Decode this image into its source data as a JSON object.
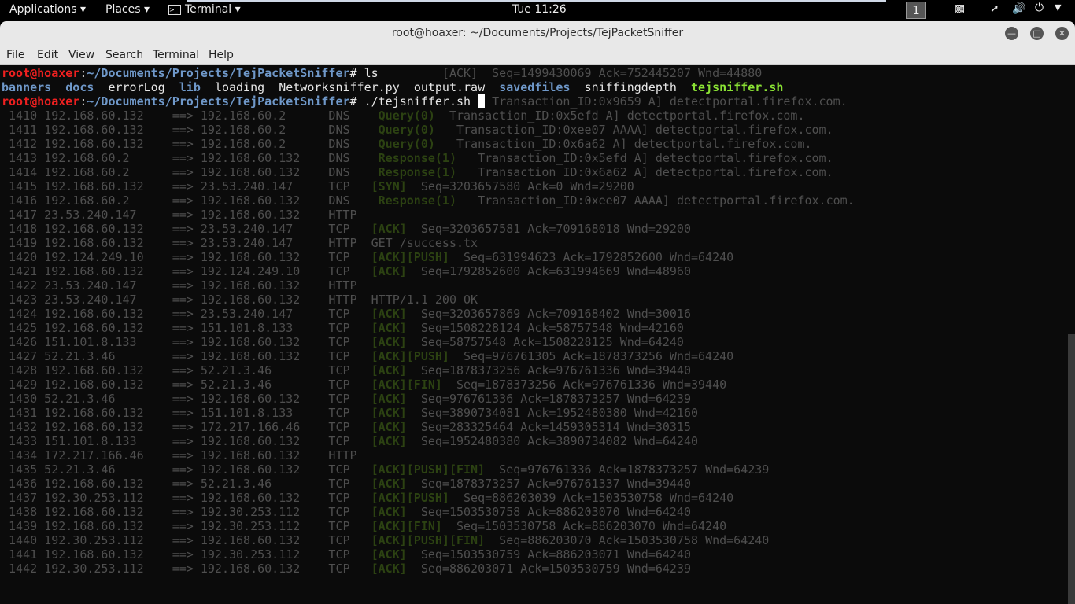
{
  "topbar": {
    "applications": "Applications ▾",
    "places": "Places ▾",
    "terminal": "Terminal ▾",
    "clock": "Tue 11:26",
    "workspace": "1",
    "icons": [
      "camera-icon",
      "network-icon",
      "volume-icon",
      "power-icon",
      "chevron-down-icon"
    ]
  },
  "window": {
    "title": "root@hoaxer: ~/Documents/Projects/TejPacketSniffer",
    "buttons": [
      "minimize",
      "maximize",
      "close"
    ]
  },
  "menu": [
    "File",
    "Edit",
    "View",
    "Search",
    "Terminal",
    "Help"
  ],
  "colors": {
    "prompt_user": "#ee2020",
    "prompt_path": "#6f98c9",
    "executable": "#8ae234",
    "flag": "#2c4212",
    "output": "#4f4f4f"
  },
  "prompt": {
    "user": "root@hoaxer",
    "path": "~/Documents/Projects/TejPacketSniffer",
    "cmd1": "ls",
    "cmd2": "./tejsniffer.sh"
  },
  "ls": [
    {
      "name": "banners",
      "type": "dir"
    },
    {
      "name": "docs",
      "type": "dir"
    },
    {
      "name": "errorLog",
      "type": "file"
    },
    {
      "name": "lib",
      "type": "dir"
    },
    {
      "name": "loading",
      "type": "file"
    },
    {
      "name": "Networksniffer.py",
      "type": "file"
    },
    {
      "name": "output.raw",
      "type": "file"
    },
    {
      "name": "savedfiles",
      "type": "dir"
    },
    {
      "name": "sniffingdepth",
      "type": "file"
    },
    {
      "name": "tejsniffer.sh",
      "type": "exec"
    }
  ],
  "remnants": {
    "line1": "[ACK]  Seq=1499430069 Ack=752445207 Wnd=44880",
    "line3": "Transaction_ID:0x9659 A] detectportal.firefox.com."
  },
  "packets": [
    {
      "n": "1410",
      "src": "192.168.60.132",
      "dst": "192.168.60.2",
      "proto": "DNS",
      "flag": "Query(0)",
      "info": "Transaction_ID:0x5efd A] detectportal.firefox.com."
    },
    {
      "n": "1411",
      "src": "192.168.60.132",
      "dst": "192.168.60.2",
      "proto": "DNS",
      "flag": "Query(0)",
      "info": " Transaction_ID:0xee07 AAAA] detectportal.firefox.com."
    },
    {
      "n": "1412",
      "src": "192.168.60.132",
      "dst": "192.168.60.2",
      "proto": "DNS",
      "flag": "Query(0)",
      "info": " Transaction_ID:0x6a62 A] detectportal.firefox.com."
    },
    {
      "n": "1413",
      "src": "192.168.60.2",
      "dst": "192.168.60.132",
      "proto": "DNS",
      "flag": "Response(1)",
      "info": " Transaction_ID:0x5efd A] detectportal.firefox.com."
    },
    {
      "n": "1414",
      "src": "192.168.60.2",
      "dst": "192.168.60.132",
      "proto": "DNS",
      "flag": "Response(1)",
      "info": " Transaction_ID:0x6a62 A] detectportal.firefox.com."
    },
    {
      "n": "1415",
      "src": "192.168.60.132",
      "dst": "23.53.240.147",
      "proto": "TCP",
      "flag": "[SYN]",
      "info": "Seq=3203657580 Ack=0 Wnd=29200"
    },
    {
      "n": "1416",
      "src": "192.168.60.2",
      "dst": "192.168.60.132",
      "proto": "DNS",
      "flag": "Response(1)",
      "info": " Transaction_ID:0xee07 AAAA] detectportal.firefox.com."
    },
    {
      "n": "1417",
      "src": "23.53.240.147",
      "dst": "192.168.60.132",
      "proto": "HTTP",
      "flag": "",
      "info": ""
    },
    {
      "n": "1418",
      "src": "192.168.60.132",
      "dst": "23.53.240.147",
      "proto": "TCP",
      "flag": "[ACK]",
      "info": "Seq=3203657581 Ack=709168018 Wnd=29200"
    },
    {
      "n": "1419",
      "src": "192.168.60.132",
      "dst": "23.53.240.147",
      "proto": "HTTP",
      "flag": "",
      "info": "GET /success.tx"
    },
    {
      "n": "1420",
      "src": "192.124.249.10",
      "dst": "192.168.60.132",
      "proto": "TCP",
      "flag": "[ACK][PUSH]",
      "info": "Seq=631994623 Ack=1792852600 Wnd=64240"
    },
    {
      "n": "1421",
      "src": "192.168.60.132",
      "dst": "192.124.249.10",
      "proto": "TCP",
      "flag": "[ACK]",
      "info": "Seq=1792852600 Ack=631994669 Wnd=48960"
    },
    {
      "n": "1422",
      "src": "23.53.240.147",
      "dst": "192.168.60.132",
      "proto": "HTTP",
      "flag": "",
      "info": ""
    },
    {
      "n": "1423",
      "src": "23.53.240.147",
      "dst": "192.168.60.132",
      "proto": "HTTP",
      "flag": "",
      "info": "HTTP/1.1 200 OK"
    },
    {
      "n": "1424",
      "src": "192.168.60.132",
      "dst": "23.53.240.147",
      "proto": "TCP",
      "flag": "[ACK]",
      "info": "Seq=3203657869 Ack=709168402 Wnd=30016"
    },
    {
      "n": "1425",
      "src": "192.168.60.132",
      "dst": "151.101.8.133",
      "proto": "TCP",
      "flag": "[ACK]",
      "info": "Seq=1508228124 Ack=58757548 Wnd=42160"
    },
    {
      "n": "1426",
      "src": "151.101.8.133",
      "dst": "192.168.60.132",
      "proto": "TCP",
      "flag": "[ACK]",
      "info": "Seq=58757548 Ack=1508228125 Wnd=64240"
    },
    {
      "n": "1427",
      "src": "52.21.3.46",
      "dst": "192.168.60.132",
      "proto": "TCP",
      "flag": "[ACK][PUSH]",
      "info": "Seq=976761305 Ack=1878373256 Wnd=64240"
    },
    {
      "n": "1428",
      "src": "192.168.60.132",
      "dst": "52.21.3.46",
      "proto": "TCP",
      "flag": "[ACK]",
      "info": "Seq=1878373256 Ack=976761336 Wnd=39440"
    },
    {
      "n": "1429",
      "src": "192.168.60.132",
      "dst": "52.21.3.46",
      "proto": "TCP",
      "flag": "[ACK][FIN]",
      "info": "Seq=1878373256 Ack=976761336 Wnd=39440"
    },
    {
      "n": "1430",
      "src": "52.21.3.46",
      "dst": "192.168.60.132",
      "proto": "TCP",
      "flag": "[ACK]",
      "info": "Seq=976761336 Ack=1878373257 Wnd=64239"
    },
    {
      "n": "1431",
      "src": "192.168.60.132",
      "dst": "151.101.8.133",
      "proto": "TCP",
      "flag": "[ACK]",
      "info": "Seq=3890734081 Ack=1952480380 Wnd=42160"
    },
    {
      "n": "1432",
      "src": "192.168.60.132",
      "dst": "172.217.166.46",
      "proto": "TCP",
      "flag": "[ACK]",
      "info": "Seq=283325464 Ack=1459305314 Wnd=30315"
    },
    {
      "n": "1433",
      "src": "151.101.8.133",
      "dst": "192.168.60.132",
      "proto": "TCP",
      "flag": "[ACK]",
      "info": "Seq=1952480380 Ack=3890734082 Wnd=64240"
    },
    {
      "n": "1434",
      "src": "172.217.166.46",
      "dst": "192.168.60.132",
      "proto": "HTTP",
      "flag": "",
      "info": ""
    },
    {
      "n": "1435",
      "src": "52.21.3.46",
      "dst": "192.168.60.132",
      "proto": "TCP",
      "flag": "[ACK][PUSH][FIN]",
      "info": "Seq=976761336 Ack=1878373257 Wnd=64239"
    },
    {
      "n": "1436",
      "src": "192.168.60.132",
      "dst": "52.21.3.46",
      "proto": "TCP",
      "flag": "[ACK]",
      "info": "Seq=1878373257 Ack=976761337 Wnd=39440"
    },
    {
      "n": "1437",
      "src": "192.30.253.112",
      "dst": "192.168.60.132",
      "proto": "TCP",
      "flag": "[ACK][PUSH]",
      "info": "Seq=886203039 Ack=1503530758 Wnd=64240"
    },
    {
      "n": "1438",
      "src": "192.168.60.132",
      "dst": "192.30.253.112",
      "proto": "TCP",
      "flag": "[ACK]",
      "info": "Seq=1503530758 Ack=886203070 Wnd=64240"
    },
    {
      "n": "1439",
      "src": "192.168.60.132",
      "dst": "192.30.253.112",
      "proto": "TCP",
      "flag": "[ACK][FIN]",
      "info": "Seq=1503530758 Ack=886203070 Wnd=64240"
    },
    {
      "n": "1440",
      "src": "192.30.253.112",
      "dst": "192.168.60.132",
      "proto": "TCP",
      "flag": "[ACK][PUSH][FIN]",
      "info": "Seq=886203070 Ack=1503530758 Wnd=64240"
    },
    {
      "n": "1441",
      "src": "192.168.60.132",
      "dst": "192.30.253.112",
      "proto": "TCP",
      "flag": "[ACK]",
      "info": "Seq=1503530759 Ack=886203071 Wnd=64240"
    },
    {
      "n": "1442",
      "src": "192.30.253.112",
      "dst": "192.168.60.132",
      "proto": "TCP",
      "flag": "[ACK]",
      "info": "Seq=886203071 Ack=1503530759 Wnd=64239"
    }
  ]
}
